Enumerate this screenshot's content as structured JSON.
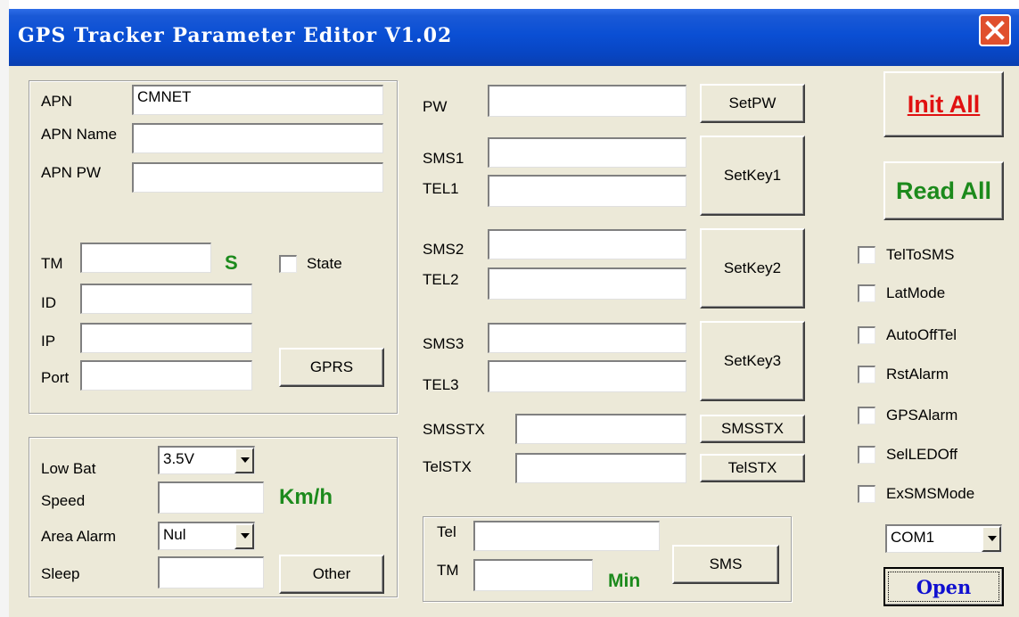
{
  "window": {
    "title": "GPS Tracker Parameter Editor V1.02"
  },
  "colors": {
    "titlebar": "#0a4fd4",
    "green": "#1c8a1c",
    "init_red": "#e01010",
    "open_blue": "#1010d0",
    "close": "#e0502d"
  },
  "apn": {
    "apn_label": "APN",
    "apn_value": "CMNET",
    "apn_name_label": "APN Name",
    "apn_name_value": "",
    "apn_pw_label": "APN PW",
    "apn_pw_value": "",
    "tm_label": "TM",
    "tm_value": "",
    "tm_unit": "S",
    "state_label": "State",
    "id_label": "ID",
    "id_value": "",
    "ip_label": "IP",
    "ip_value": "",
    "port_label": "Port",
    "port_value": "",
    "gprs_button": "GPRS"
  },
  "battery": {
    "low_bat_label": "Low Bat",
    "low_bat_value": "3.5V",
    "speed_label": "Speed",
    "speed_value": "",
    "speed_unit": "Km/h",
    "area_alarm_label": "Area Alarm",
    "area_alarm_value": "Nul",
    "sleep_label": "Sleep",
    "sleep_value": "",
    "other_button": "Other"
  },
  "keys": {
    "pw_label": "PW",
    "pw_value": "",
    "setpw_button": "SetPW",
    "sms1_label": "SMS1",
    "tel1_label": "TEL1",
    "setkey1_button": "SetKey1",
    "sms2_label": "SMS2",
    "tel2_label": "TEL2",
    "setkey2_button": "SetKey2",
    "sms3_label": "SMS3",
    "tel3_label": "TEL3",
    "setkey3_button": "SetKey3",
    "smsstx_label": "SMSSTX",
    "smsstx_button": "SMSSTX",
    "telstx_label": "TelSTX",
    "telstx_button": "TelSTX"
  },
  "sms": {
    "tel_label": "Tel",
    "tel_value": "",
    "tm_label": "TM",
    "tm_value": "",
    "tm_unit": "Min",
    "sms_button": "SMS"
  },
  "right": {
    "init_all": "Init All",
    "read_all": "Read All",
    "options": [
      "TelToSMS",
      "LatMode",
      "AutoOffTel",
      "RstAlarm",
      "GPSAlarm",
      "SelLEDOff",
      "ExSMSMode"
    ],
    "com_port": "COM1",
    "open_button": "Open"
  }
}
